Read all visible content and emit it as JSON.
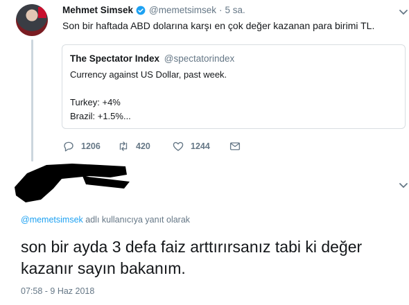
{
  "tweet": {
    "author_name": "Mehmet Simsek",
    "author_handle": "@memetsimsek",
    "separator": "·",
    "time": "5 sa.",
    "text": "Son bir haftada ABD dolarına karşı en çok değer kazanan para birimi TL.",
    "quote": {
      "author_name": "The Spectator Index",
      "author_handle": "@spectatorindex",
      "lines": [
        "Currency against US Dollar, past week.",
        "Turkey: +4%",
        "Brazil: +1.5%..."
      ]
    },
    "actions": {
      "reply_count": "1206",
      "retweet_count": "420",
      "like_count": "1244"
    },
    "icons": [
      "verified-icon",
      "chevron-down-icon",
      "reply-icon",
      "retweet-icon",
      "like-icon",
      "message-icon"
    ]
  },
  "reply": {
    "reply_to_mention": "@memetsimsek",
    "reply_to_suffix": " adlı kullanıcıya yanıt olarak",
    "text": "son bir ayda 3 defa faiz arttırırsanız tabi ki değer kazanır sayın bakanım.",
    "timestamp": "07:58 - 9 Haz 2018"
  },
  "colors": {
    "accent": "#1da1f2",
    "muted": "#657786",
    "text": "#14171a",
    "border": "#d8dde1"
  }
}
